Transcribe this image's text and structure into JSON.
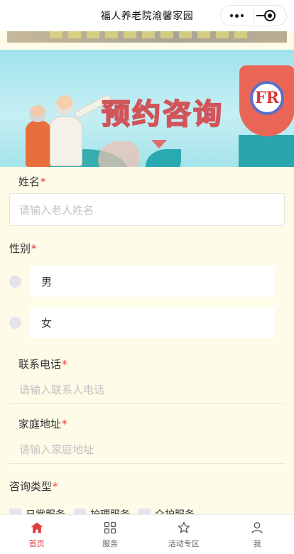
{
  "header": {
    "title": "福人养老院渝馨家园"
  },
  "banner": {
    "title": "预约咨询",
    "logo_letter": "FR"
  },
  "form": {
    "name_label": "姓名",
    "name_placeholder": "请输入老人姓名",
    "gender_label": "性别",
    "gender_options": [
      "男",
      "女"
    ],
    "phone_label": "联系电话",
    "phone_placeholder": "请输入联系人电话",
    "address_label": "家庭地址",
    "address_placeholder": "请输入家庭地址",
    "consult_type_label": "咨询类型",
    "consult_types": [
      "日常服务",
      "护理服务",
      "介护服务"
    ],
    "required_mark": "*"
  },
  "tabbar": {
    "items": [
      {
        "label": "首页",
        "icon": "home-icon",
        "active": true
      },
      {
        "label": "服务",
        "icon": "grid-icon",
        "active": false
      },
      {
        "label": "活动专区",
        "icon": "star-icon",
        "active": false
      },
      {
        "label": "我",
        "icon": "user-icon",
        "active": false
      }
    ]
  },
  "colors": {
    "accent": "#e03a3a",
    "page_bg": "#fefce8"
  }
}
